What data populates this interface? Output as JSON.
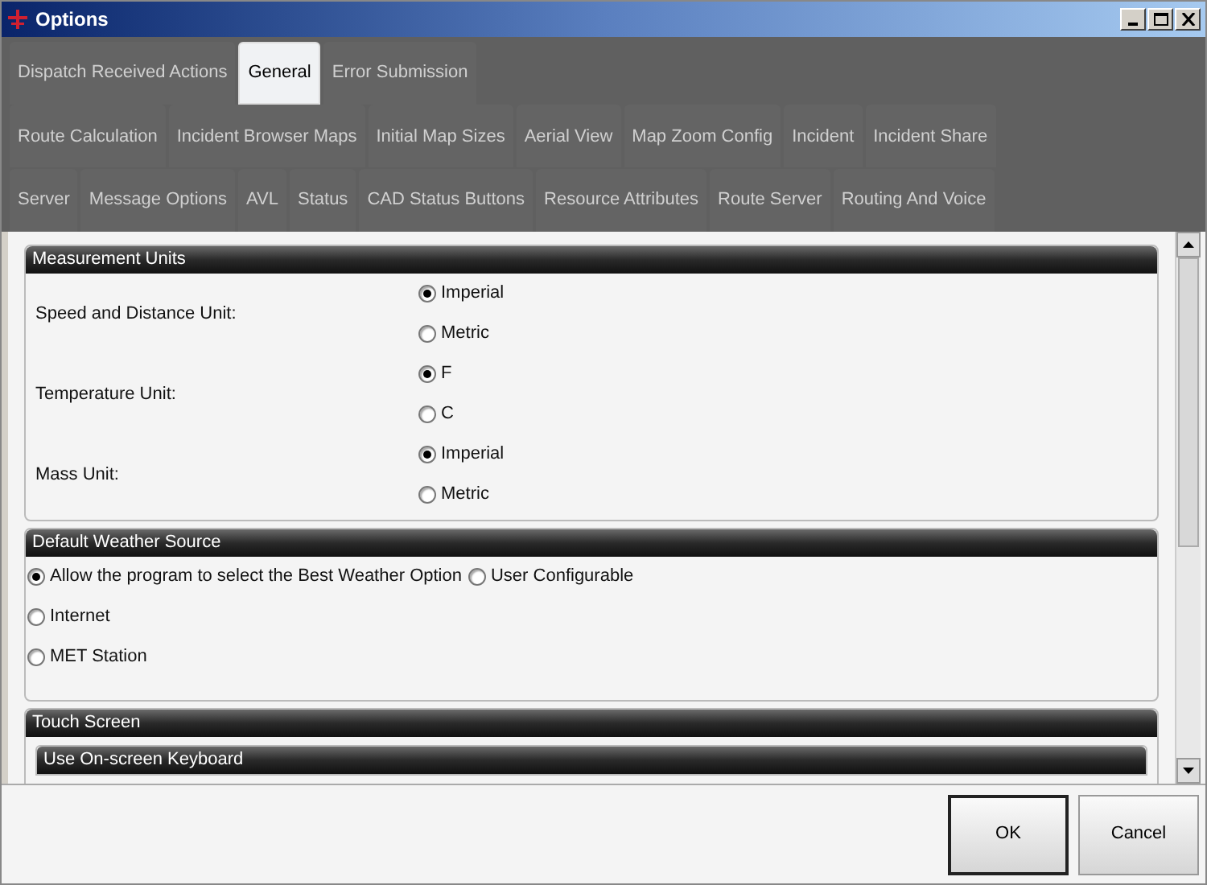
{
  "window": {
    "title": "Options"
  },
  "tab_rows": [
    [
      {
        "label": "Dispatch Received Actions",
        "selected": false
      },
      {
        "label": "General",
        "selected": true
      },
      {
        "label": "Error Submission",
        "selected": false
      }
    ],
    [
      {
        "label": "Route Calculation",
        "selected": false
      },
      {
        "label": "Incident Browser Maps",
        "selected": false
      },
      {
        "label": "Initial Map Sizes",
        "selected": false
      },
      {
        "label": "Aerial View",
        "selected": false
      },
      {
        "label": "Map Zoom Config",
        "selected": false
      },
      {
        "label": "Incident",
        "selected": false
      },
      {
        "label": "Incident Share",
        "selected": false
      }
    ],
    [
      {
        "label": "Server",
        "selected": false
      },
      {
        "label": "Message Options",
        "selected": false
      },
      {
        "label": "AVL",
        "selected": false
      },
      {
        "label": "Status",
        "selected": false
      },
      {
        "label": "CAD Status Buttons",
        "selected": false
      },
      {
        "label": "Resource Attributes",
        "selected": false
      },
      {
        "label": "Route Server",
        "selected": false
      },
      {
        "label": "Routing And Voice",
        "selected": false
      }
    ]
  ],
  "measurement_units": {
    "title": "Measurement Units",
    "groups": [
      {
        "label": "Speed and Distance Unit:",
        "options": [
          {
            "label": "Imperial",
            "selected": true
          },
          {
            "label": "Metric",
            "selected": false
          }
        ]
      },
      {
        "label": "Temperature Unit:",
        "options": [
          {
            "label": "F",
            "selected": true
          },
          {
            "label": "C",
            "selected": false
          }
        ]
      },
      {
        "label": "Mass Unit:",
        "options": [
          {
            "label": "Imperial",
            "selected": true
          },
          {
            "label": "Metric",
            "selected": false
          }
        ]
      }
    ]
  },
  "default_weather_source": {
    "title": "Default Weather Source",
    "options": [
      {
        "label": "Allow the program to select the Best Weather Option",
        "selected": true
      },
      {
        "label": "User Configurable",
        "selected": false
      },
      {
        "label": "Internet",
        "selected": false
      },
      {
        "label": "MET Station",
        "selected": false
      }
    ]
  },
  "touch_screen": {
    "title": "Touch Screen",
    "subsection": {
      "title": "Use On-screen Keyboard"
    }
  },
  "buttons": [
    "OK",
    "Cancel"
  ]
}
